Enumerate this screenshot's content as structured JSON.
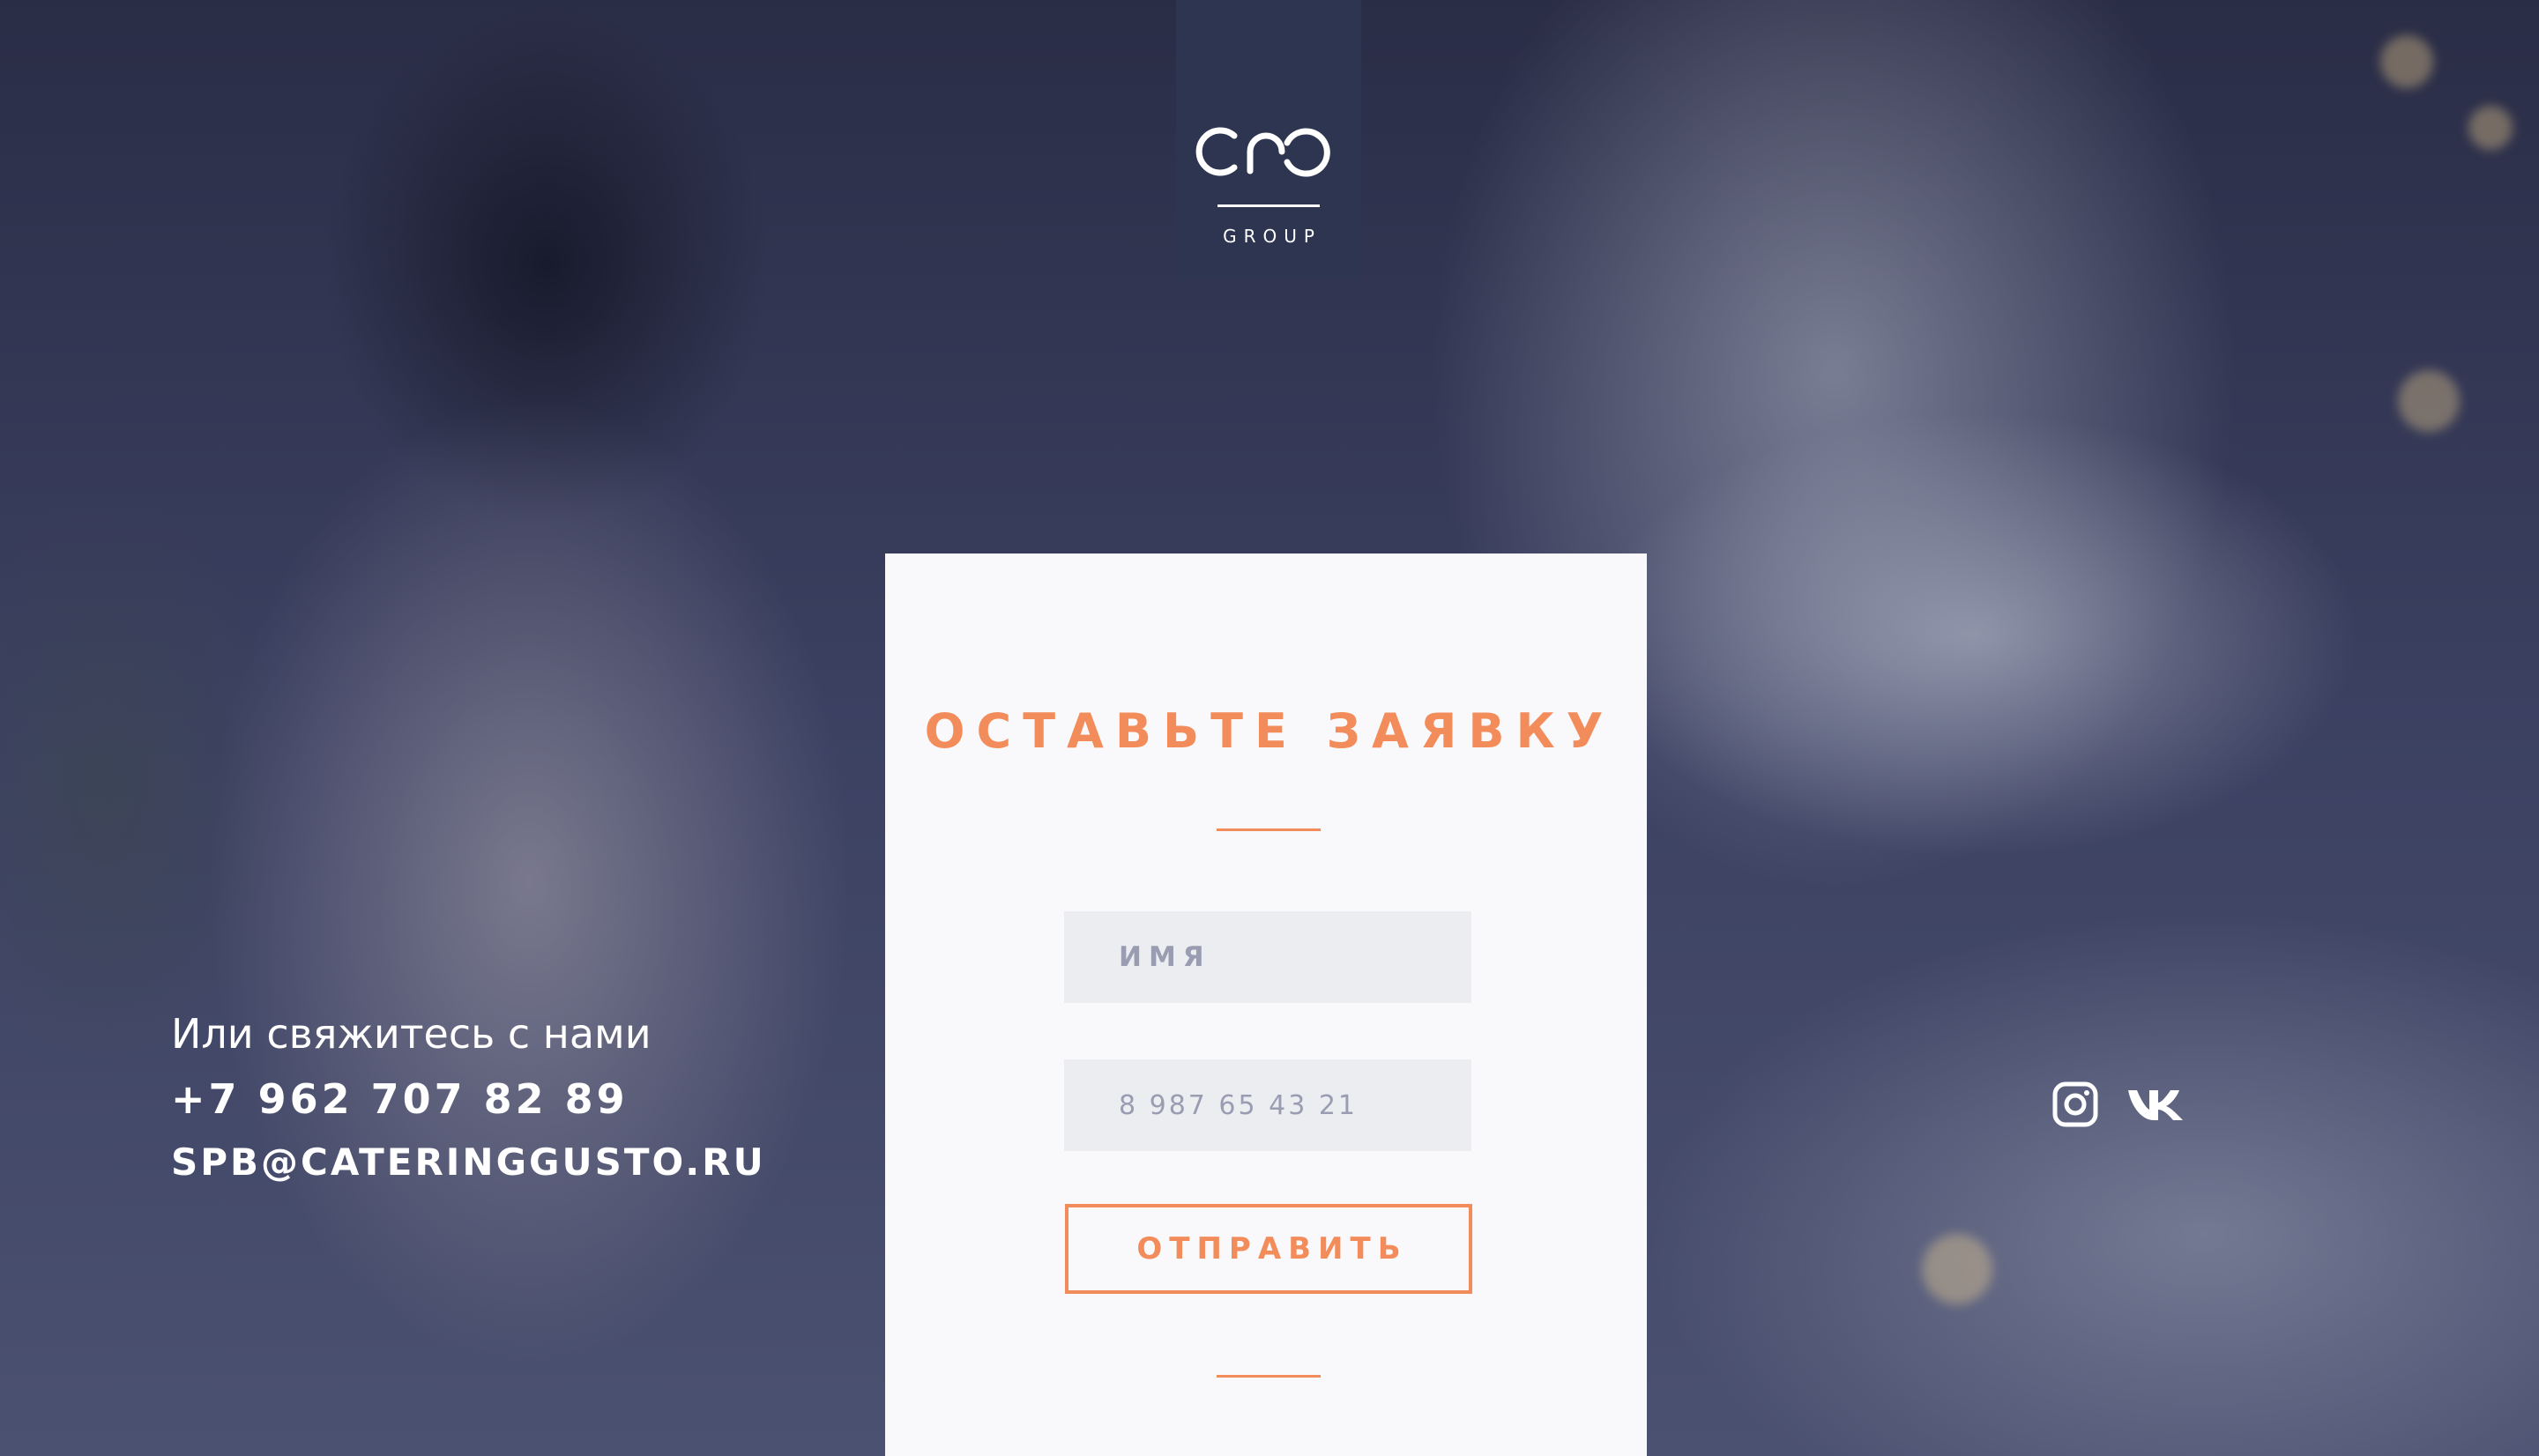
{
  "header": {
    "logo_text": "GROUP"
  },
  "form": {
    "title": "ОСТАВЬТЕ ЗАЯВКУ",
    "name_placeholder": "ИМЯ",
    "phone_placeholder": "8 987 65 43 21",
    "submit_label": "ОТПРАВИТЬ"
  },
  "contacts": {
    "lead": "Или свяжитесь с нами",
    "phone": "+7 962 707 82 89",
    "email": "SPB@CATERINGGUSTO.RU"
  },
  "social": {
    "icons": [
      "instagram-icon",
      "vk-icon"
    ]
  },
  "colors": {
    "accent": "#f38c5b",
    "logo_bg": "#2e3550",
    "card_bg": "#f9f9fb",
    "field_bg": "#ecedf1"
  }
}
